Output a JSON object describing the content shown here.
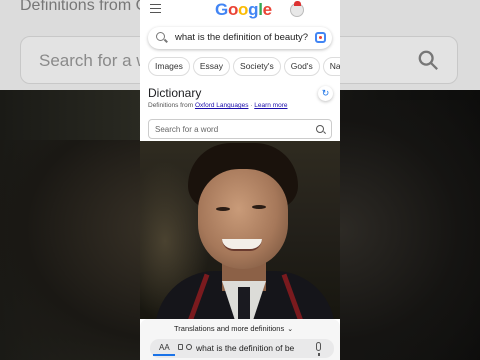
{
  "background": {
    "title": "Definitions from Oxford Languages",
    "search_placeholder": "Search for a word"
  },
  "google": {
    "logo_letters": [
      "G",
      "o",
      "o",
      "g",
      "l",
      "e"
    ],
    "logo_colors": [
      "#4285F4",
      "#EA4335",
      "#FBBC05",
      "#4285F4",
      "#34A853",
      "#EA4335"
    ]
  },
  "search": {
    "query": "what is the definition of beauty?"
  },
  "chips": [
    "Images",
    "Essay",
    "Society's",
    "God's",
    "Natural"
  ],
  "dictionary": {
    "title": "Dictionary",
    "sub_prefix": "Definitions from",
    "source_link": "Oxford Languages",
    "separator": "·",
    "learn_more": "Learn more",
    "word_placeholder": "Search for a word"
  },
  "sheet": {
    "translations_label": "Translations and more definitions",
    "aa_label": "AA",
    "url_text": "what is the definition of be"
  },
  "icons": {
    "menu": "menu-icon",
    "search": "search-icon",
    "lens": "lens-icon",
    "refresh": "refresh-icon",
    "mic": "mic-icon",
    "lock": "lock-icon"
  }
}
